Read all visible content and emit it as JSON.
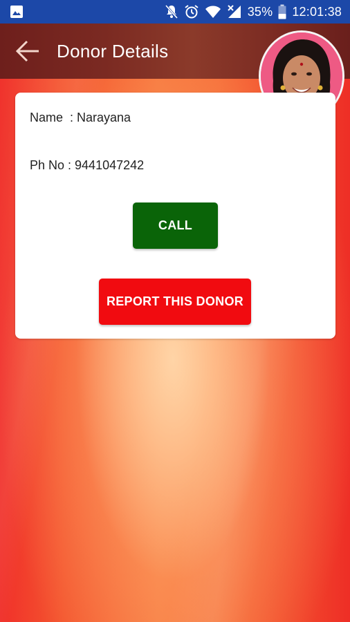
{
  "status_bar": {
    "battery_percent": "35%",
    "time": "12:01:38",
    "icons": [
      "image-icon",
      "notifications-off-icon",
      "alarm-icon",
      "wifi-icon",
      "cellular-signal-icon",
      "battery-icon"
    ]
  },
  "app_bar": {
    "title": "Donor Details",
    "back_icon": "arrow-back-icon"
  },
  "donor": {
    "name_line": "Name  : Narayana",
    "phone_line": "Ph No : 9441047242"
  },
  "actions": {
    "call_label": "CALL",
    "report_label": "REPORT THIS DONOR"
  },
  "colors": {
    "status_bar": "#1c48a8",
    "app_bar": "#7b2a22",
    "call_button": "#0a6408",
    "report_button": "#f10b10",
    "card": "#ffffff",
    "avatar_background": "#ee5a84"
  }
}
